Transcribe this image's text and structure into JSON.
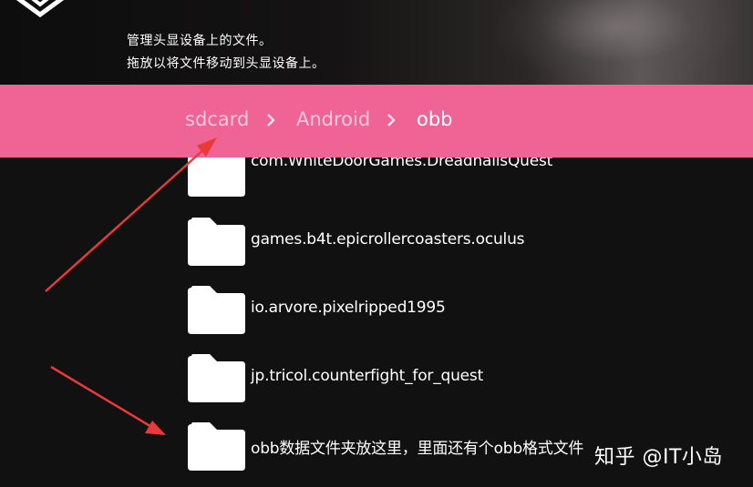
{
  "header": {
    "instruction_line_1": "管理头显设备上的文件。",
    "instruction_line_2": "拖放以将文件移动到头显设备上。"
  },
  "breadcrumb": {
    "items": [
      {
        "label": "sdcard",
        "icon": "chevron-right-icon"
      },
      {
        "label": "Android",
        "icon": "chevron-right-icon"
      },
      {
        "label": "obb"
      }
    ]
  },
  "files": [
    {
      "name": "com.WhiteDoorGames.DreadhallsQuest",
      "icon": "folder-icon"
    },
    {
      "name": "games.b4t.epicrollercoasters.oculus",
      "icon": "folder-icon"
    },
    {
      "name": "io.arvore.pixelripped1995",
      "icon": "folder-icon"
    },
    {
      "name": "jp.tricol.counterfight_for_quest",
      "icon": "folder-icon"
    },
    {
      "name": "obb数据文件夹放这里，里面还有个obb格式文件",
      "icon": "folder-icon"
    }
  ],
  "watermark": "知乎 @IT小岛",
  "colors": {
    "breadcrumb_bar": "#ef6495",
    "background": "#111111",
    "annotation_arrow": "#e83a3a",
    "folder": "#ffffff"
  }
}
